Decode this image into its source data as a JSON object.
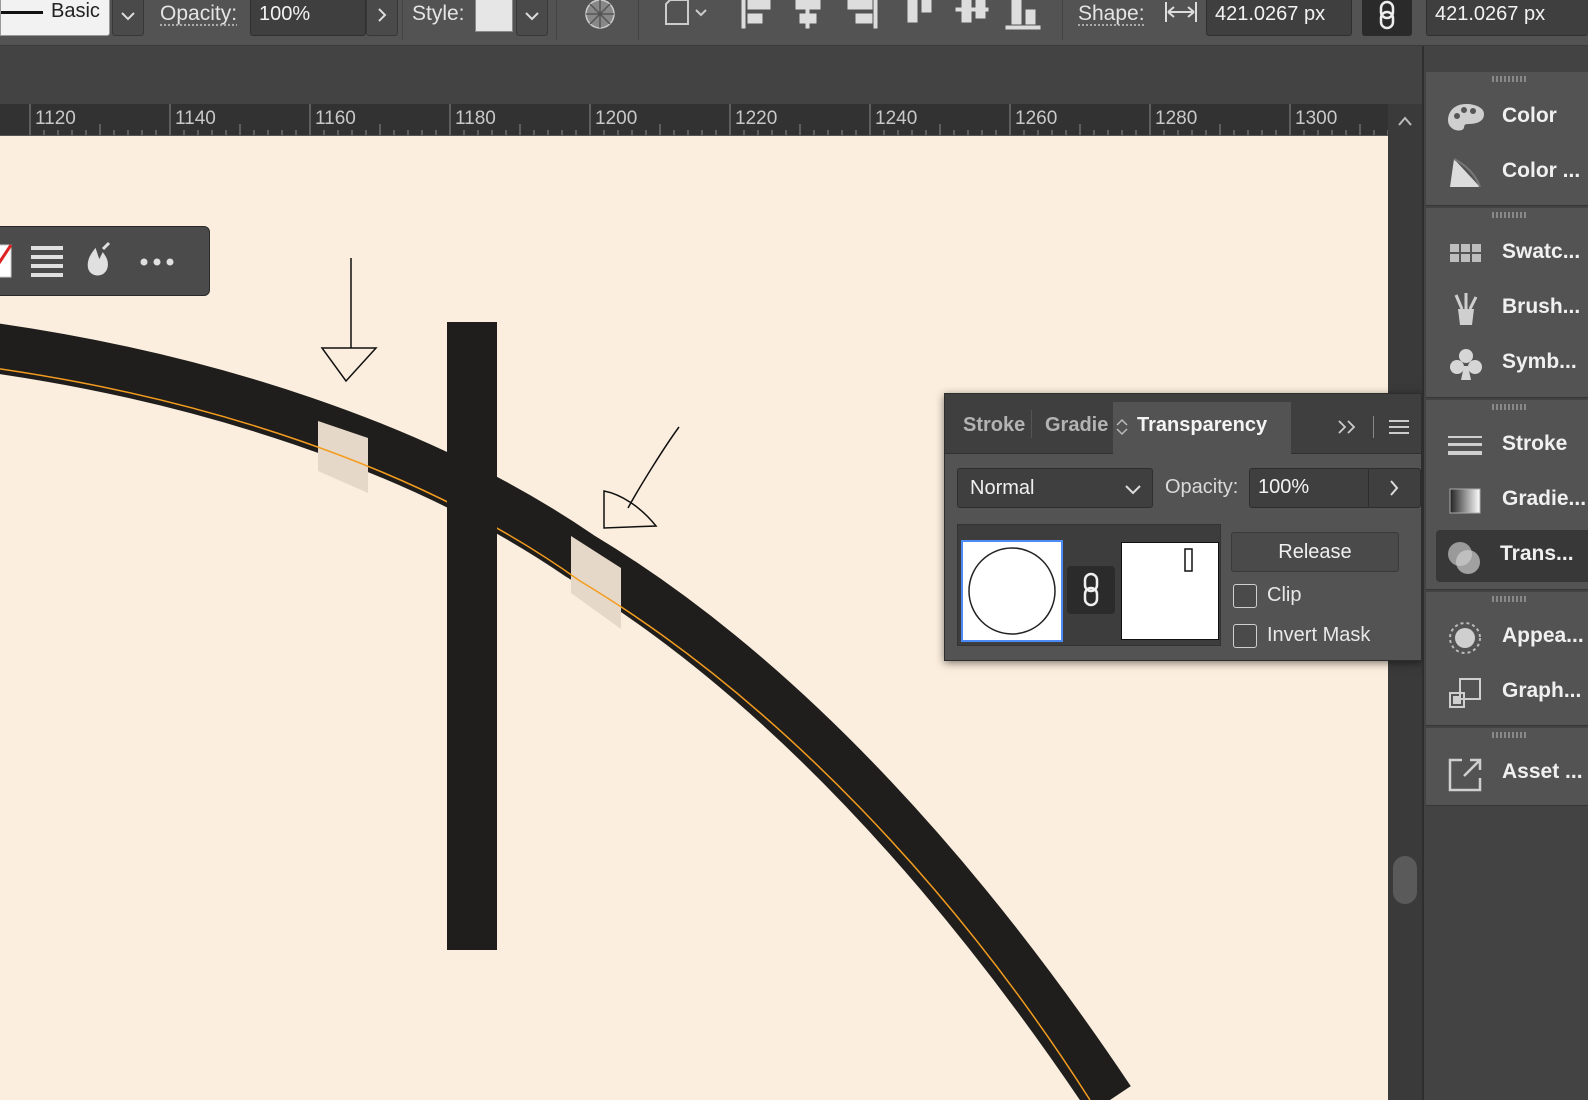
{
  "control_bar": {
    "stroke_profile": "Basic",
    "opacity_label": "Opacity:",
    "opacity_value": "100%",
    "style_label": "Style:",
    "shape_label": "Shape:",
    "width_value": "421.0267 px",
    "height_value": "421.0267 px"
  },
  "ruler": {
    "ticks": [
      "1120",
      "1140",
      "1160",
      "1180",
      "1200",
      "1220",
      "1240",
      "1260",
      "1280",
      "1300"
    ]
  },
  "transparency_panel": {
    "tabs": [
      "Stroke",
      "Gradie",
      "Transparency"
    ],
    "blend_mode": "Normal",
    "opacity_label": "Opacity:",
    "opacity_value": "100%",
    "release_label": "Release",
    "clip_label": "Clip",
    "invert_mask_label": "Invert Mask",
    "clip_checked": false,
    "invert_mask_checked": false
  },
  "dock": {
    "items": [
      {
        "label": "Color",
        "icon": "palette-icon"
      },
      {
        "label": "Color ...",
        "icon": "color-guide-icon"
      },
      {
        "label": "Swatc...",
        "icon": "swatches-icon"
      },
      {
        "label": "Brush...",
        "icon": "brushes-icon"
      },
      {
        "label": "Symb...",
        "icon": "symbols-icon"
      },
      {
        "label": "Stroke",
        "icon": "stroke-icon"
      },
      {
        "label": "Gradie...",
        "icon": "gradient-icon"
      },
      {
        "label": "Trans...",
        "icon": "transparency-icon"
      },
      {
        "label": "Appea...",
        "icon": "appearance-icon"
      },
      {
        "label": "Graph...",
        "icon": "graphic-styles-icon"
      },
      {
        "label": "Asset ...",
        "icon": "asset-export-icon"
      }
    ]
  },
  "colors": {
    "artboard": "#fbeede",
    "path_stroke": "#1f1e1c",
    "selection_highlight": "#f39c1f",
    "gap_fill": "#e5d8c8",
    "panel_bg": "#535353",
    "accent_blue": "#4c8bf5"
  }
}
